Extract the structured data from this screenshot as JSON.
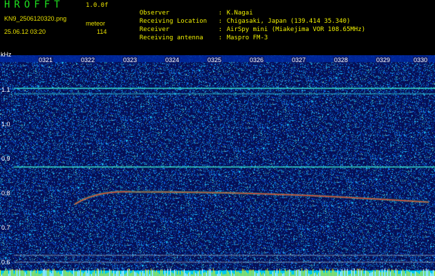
{
  "header": {
    "app_name": "HROFFT",
    "app_version": "1.0.0f",
    "file_name": "KN9_2506120320.png",
    "detect_type": "meteor",
    "date_time": "25.06.12 03:20",
    "count": "114"
  },
  "info": [
    {
      "key": "Observer",
      "value": "K.Nagai"
    },
    {
      "key": "Receiving Location",
      "value": "Chigasaki, Japan (139.414 35.340)"
    },
    {
      "key": "Receiver",
      "value": "AirSpy mini (Miakejima VOR 108.65MHz)"
    },
    {
      "key": "Receiving antenna",
      "value": "Maspro FM-3"
    }
  ],
  "axis": {
    "unit": "kHz",
    "y_ticks": [
      "1.1",
      "1.0",
      "0.9",
      "0.8",
      "0.7",
      "0.6"
    ],
    "time_labels": [
      "0321",
      "0322",
      "0323",
      "0324",
      "0325",
      "0326",
      "0327",
      "0328",
      "0329",
      "0330"
    ]
  },
  "colors": {
    "background": "#000000",
    "plot_noise_low": "#08115a",
    "plot_noise_high": "#2a8cff",
    "signal": "#ff3030",
    "baseline": "#00d0ff",
    "header_text": "#f0f000",
    "app_name": "#1fe01f"
  }
}
